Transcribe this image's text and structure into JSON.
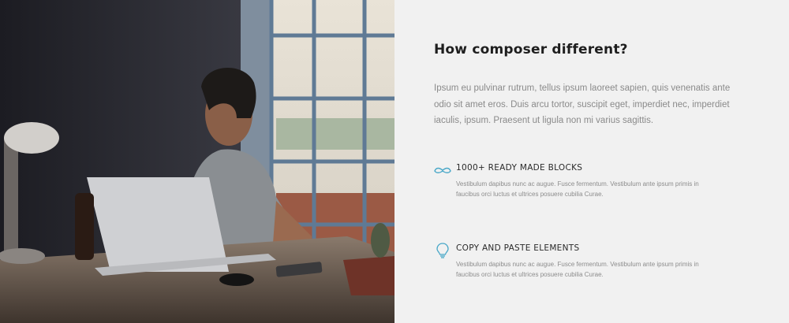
{
  "hero_image": {
    "description_icon": "photo"
  },
  "section": {
    "title": "How composer different?",
    "intro": "Ipsum eu pulvinar rutrum, tellus ipsum laoreet sapien, quis venenatis ante odio sit amet eros. Duis arcu tortor, suscipit eget, imperdiet nec, imperdiet iaculis, ipsum. Praesent ut ligula non mi varius sagittis."
  },
  "features": [
    {
      "icon": "mustache-icon",
      "title": "1000+ READY MADE BLOCKS",
      "description": "Vestibulum dapibus nunc ac augue. Fusce fermentum. Vestibulum ante ipsum primis in faucibus orci luctus et ultrices posuere cubilia Curae."
    },
    {
      "icon": "lightbulb-icon",
      "title": "COPY AND PASTE ELEMENTS",
      "description": "Vestibulum dapibus nunc ac augue. Fusce fermentum. Vestibulum ante ipsum primis in faucibus orci luctus et ultrices posuere cubilia Curae."
    }
  ],
  "colors": {
    "accent": "#4aa8c8",
    "background": "#f1f1f1",
    "heading": "#1e1e1e",
    "body_text": "#8a8a8a"
  }
}
